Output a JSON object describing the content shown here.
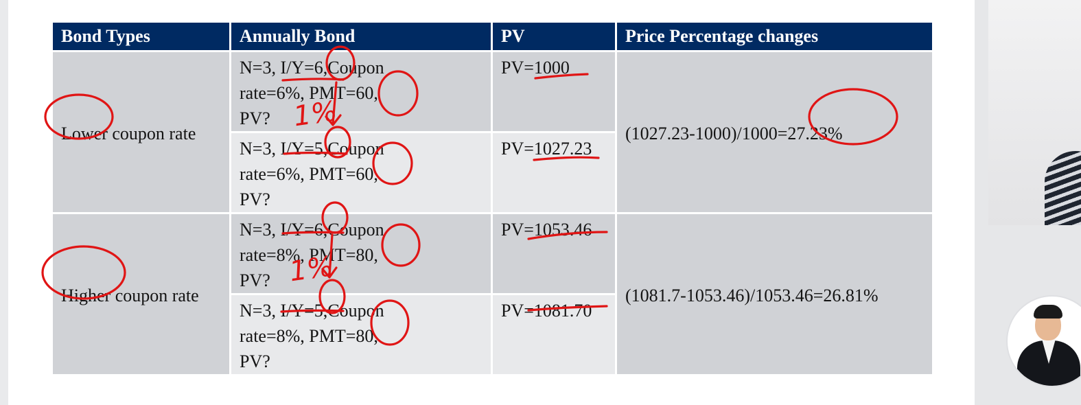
{
  "table": {
    "headers": [
      "Bond Types",
      "Annually Bond",
      "PV",
      "Price Percentage changes"
    ],
    "groups": [
      {
        "type": "Lower coupon rate",
        "rows": [
          {
            "line1": "N=3, I/Y=6,Coupon",
            "line2": "rate=6%, PMT=60,",
            "line3": "PV?",
            "pv": "PV=1000"
          },
          {
            "line1": "N=3, I/Y=5,Coupon",
            "line2": "rate=6%, PMT=60,",
            "line3": "PV?",
            "pv": "PV=1027.23"
          }
        ],
        "change": "(1027.23-1000)/1000=27.23%"
      },
      {
        "type": "Higher coupon rate",
        "rows": [
          {
            "line1": "N=3, I/Y=6,Coupon",
            "line2": "rate=8%, PMT=80,",
            "line3": "PV?",
            "pv": "PV=1053.46"
          },
          {
            "line1": "N=3, I/Y=5,Coupon",
            "line2": "rate=8%, PMT=80,",
            "line3": "PV?",
            "pv": "PV=1081.70"
          }
        ],
        "change": "(1081.7-1053.46)/1053.46=26.81%"
      }
    ]
  },
  "annotations": {
    "rate_drop_1": "1%",
    "rate_drop_2": "1%"
  },
  "colors": {
    "header_bg": "#002a62",
    "row_dark": "#d0d2d6",
    "row_light": "#e8e9eb",
    "ink": "#e01515"
  }
}
